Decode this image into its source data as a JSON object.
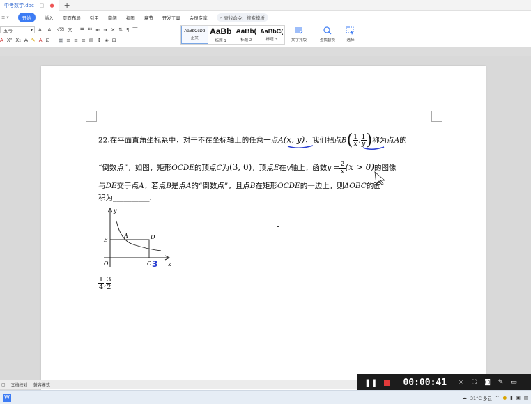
{
  "titlebar": {
    "doc_tab": "中考数学.doc",
    "new_tab": "+"
  },
  "menubar": {
    "items": [
      "开始",
      "插入",
      "页面布局",
      "引用",
      "审阅",
      "视图",
      "章节",
      "开发工具",
      "会员专享"
    ],
    "search_text": "查找命令、搜索模板"
  },
  "ribbon": {
    "font_size": "五号",
    "styles": [
      {
        "preview": "AaBbCcDd",
        "name": "正文"
      },
      {
        "preview": "AaBb",
        "name": "标题 1"
      },
      {
        "preview": "AaBb(",
        "name": "标题 2"
      },
      {
        "preview": "AaBbC(",
        "name": "标题 3"
      }
    ],
    "text_layout": "文字排版",
    "find_replace": "查找替换",
    "select": "选择"
  },
  "question": {
    "l1_a": "22.在平面直角坐标系中，对于不在坐标轴上的任意一点",
    "pt_A": "A",
    "xy": "(x, y)",
    "l1_b": "，我们把点",
    "pt_B": "B",
    "one": "1",
    "x": "x",
    "y": "y",
    "l1_c": "称为点",
    "l1_d": "的",
    "l2_a": "“倒数点”，如图，矩形",
    "ocde": "OCDE",
    "l2_b": "的顶点",
    "c": "C",
    "l2_c": "为",
    "c_coord": "(3, 0)",
    "l2_d": "，顶点",
    "e": "E",
    "l2_e": "在",
    "l2_f": "轴上，函数",
    "fn_y": "y =",
    "two": "2",
    "domain": "(x > 0)",
    "l2_g": "的图像",
    "l3_a": "与",
    "de": "DE",
    "l3_b": "交于点",
    "l3_c": "，若点",
    "l3_d": "是点",
    "l3_e": "的“倒数点”，且点",
    "l3_f": "在矩形",
    "l3_g": "的一边上，则",
    "tri": "ΔOBC",
    "l3_h": "的面",
    "l4": "积为__________.",
    "ans_num1": "1",
    "ans_den1": "4",
    "ans_comma": ",",
    "ans_num2": "3",
    "ans_den2": "2"
  },
  "graph": {
    "y": "y",
    "x": "x",
    "O": "O",
    "E": "E",
    "A": "A",
    "D": "D",
    "C": "C",
    "hand3": "3"
  },
  "statusbar": {
    "proof": "文档校对",
    "compat": "兼容模式"
  },
  "recorder": {
    "timer": "00:00:41"
  },
  "taskbar": {
    "weather": "31°C 多云"
  }
}
